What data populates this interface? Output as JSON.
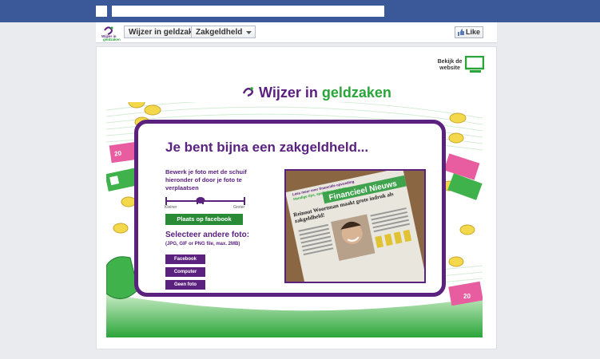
{
  "header": {
    "crumbs": [
      "Wijzer in geldzaken",
      "Zakgeldheld"
    ],
    "like_label": "Like",
    "thumb_brand": [
      "Wijzer in",
      "geldzaken"
    ]
  },
  "app": {
    "site_link": "Bekijk de website",
    "brand": {
      "part1": "Wijzer in ",
      "part2": "geldzaken"
    },
    "title": "Je bent bijna een zakgeldheld...",
    "instructions": "Bewerk je foto met de schuif hieronder of door je foto te verplaatsen",
    "slider": {
      "min_label": "Kleiner",
      "max_label": "Groter",
      "level": 0.45
    },
    "publish_button": "Plaats op facebook",
    "select_heading": "Selecteer andere foto:",
    "select_sub": "(JPG, GIF or PNG file, max. 2MB)",
    "source_buttons": [
      "Facebook",
      "Computer",
      "Geen foto"
    ],
    "newspaper": {
      "masthead": "Financieel Nieuws",
      "headline": "Reinout Woortman maakt grote indruk als zakgeldheld!",
      "teaser": "Lees meer over financiële opvoeding",
      "teaser2": "Handige tips, spelletjes en tests"
    }
  },
  "colors": {
    "facebook_blue": "#3b5998",
    "purple": "#5b217f",
    "green": "#2a8b36"
  }
}
